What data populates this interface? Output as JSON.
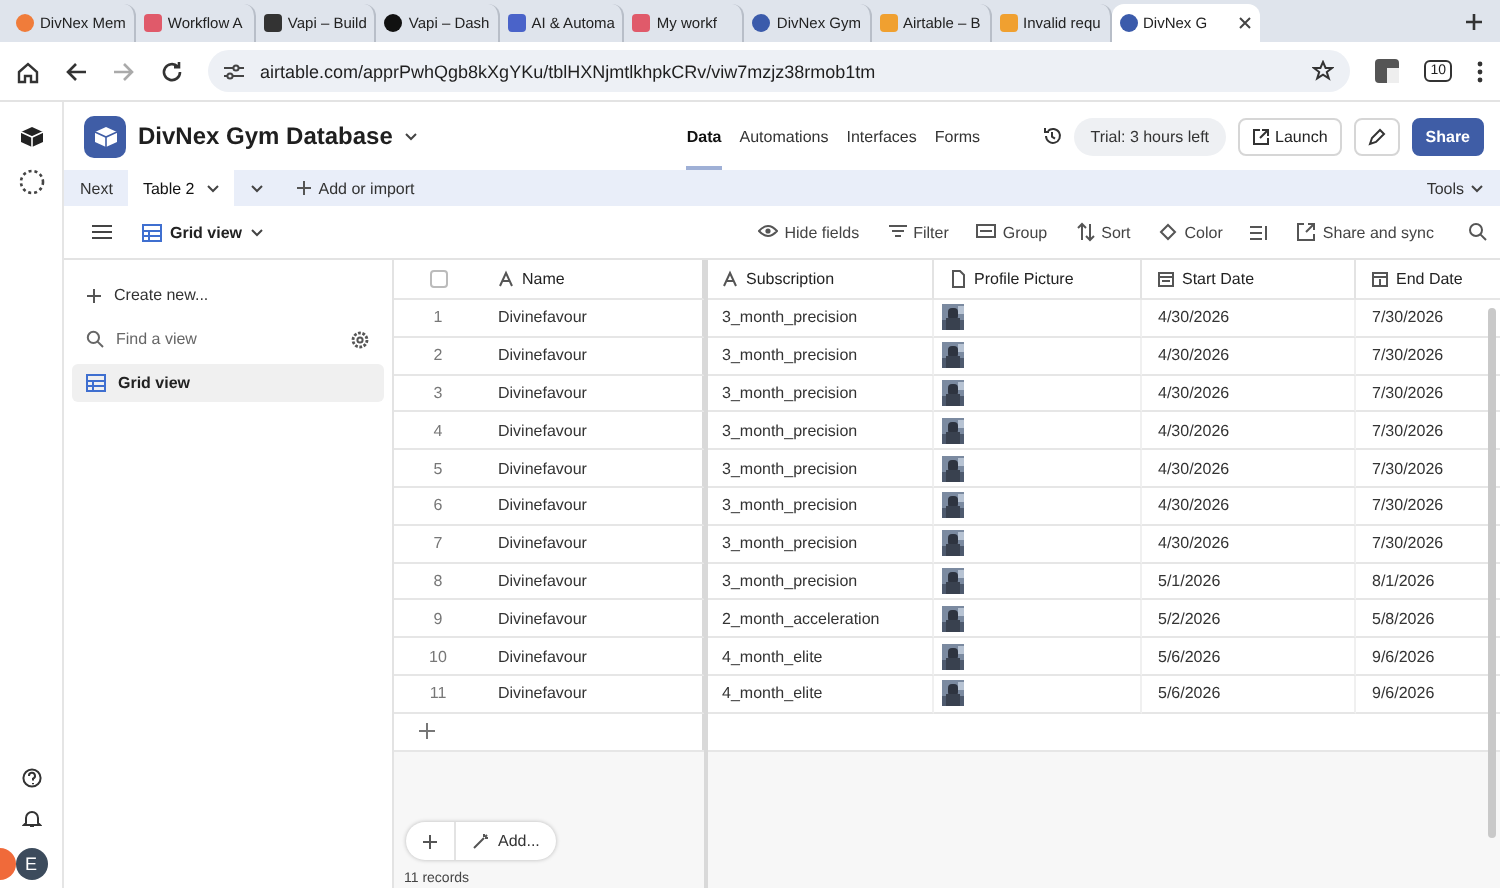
{
  "browser_tabs": [
    {
      "title": "DivNex Mem",
      "selected": false
    },
    {
      "title": "Workflow A",
      "selected": false
    },
    {
      "title": "Vapi – Build",
      "selected": false
    },
    {
      "title": "Vapi – Dash",
      "selected": false
    },
    {
      "title": "AI & Automa",
      "selected": false
    },
    {
      "title": "My workf",
      "selected": false
    },
    {
      "title": "DivNex Gym",
      "selected": false
    },
    {
      "title": "Airtable – B",
      "selected": false
    },
    {
      "title": "Invalid requ",
      "selected": false
    },
    {
      "title": "DivNex G",
      "selected": true
    }
  ],
  "address_bar": {
    "url": "airtable.com/apprPwhQgb8kXgYKu/tblHXNjmtlkhpkCRv/viw7mzjz38rmob1tm",
    "extensions_badge": "10"
  },
  "base": {
    "title": "DivNex Gym Database"
  },
  "nav_tabs": [
    {
      "label": "Data",
      "selected": true
    },
    {
      "label": "Automations",
      "selected": false
    },
    {
      "label": "Interfaces",
      "selected": false
    },
    {
      "label": "Forms",
      "selected": false
    }
  ],
  "trial_badge": "Trial: 3 hours left",
  "header_buttons": {
    "launch": "Launch",
    "share": "Share"
  },
  "table_bar": {
    "prev_label": "Next",
    "tables": [
      {
        "label": "Table 2",
        "selected": true
      }
    ],
    "add_label": "Add or import",
    "tools_label": "Tools"
  },
  "view_bar": {
    "view_name": "Grid view",
    "actions": [
      "Hide fields",
      "Filter",
      "Group",
      "Sort",
      "Color",
      "Share and sync"
    ]
  },
  "sidebar": {
    "create_label": "Create new...",
    "search": {
      "placeholder": "Find a view"
    },
    "items": [
      {
        "label": "Grid view",
        "selected": true
      }
    ]
  },
  "table": {
    "select_all": {
      "checked": false
    },
    "columns": [
      "Name",
      "Subscription",
      "Profile Picture",
      "Start Date",
      "End Date"
    ],
    "rows": [
      {
        "number": "1",
        "name": "Divinefavour",
        "subscription": "3_month_precision",
        "start": "4/30/2026",
        "end": "7/30/2026"
      },
      {
        "number": "2",
        "name": "Divinefavour",
        "subscription": "3_month_precision",
        "start": "4/30/2026",
        "end": "7/30/2026"
      },
      {
        "number": "3",
        "name": "Divinefavour",
        "subscription": "3_month_precision",
        "start": "4/30/2026",
        "end": "7/30/2026"
      },
      {
        "number": "4",
        "name": "Divinefavour",
        "subscription": "3_month_precision",
        "start": "4/30/2026",
        "end": "7/30/2026"
      },
      {
        "number": "5",
        "name": "Divinefavour",
        "subscription": "3_month_precision",
        "start": "4/30/2026",
        "end": "7/30/2026"
      },
      {
        "number": "6",
        "name": "Divinefavour",
        "subscription": "3_month_precision",
        "start": "4/30/2026",
        "end": "7/30/2026"
      },
      {
        "number": "7",
        "name": "Divinefavour",
        "subscription": "3_month_precision",
        "start": "4/30/2026",
        "end": "7/30/2026"
      },
      {
        "number": "8",
        "name": "Divinefavour",
        "subscription": "3_month_precision",
        "start": "5/1/2026",
        "end": "8/1/2026"
      },
      {
        "number": "9",
        "name": "Divinefavour",
        "subscription": "2_month_acceleration",
        "start": "5/2/2026",
        "end": "5/8/2026"
      },
      {
        "number": "10",
        "name": "Divinefavour",
        "subscription": "4_month_elite",
        "start": "5/6/2026",
        "end": "9/6/2026"
      },
      {
        "number": "11",
        "name": "Divinefavour",
        "subscription": "4_month_elite",
        "start": "5/6/2026",
        "end": "9/6/2026"
      }
    ]
  },
  "footer": {
    "add_label": "Add...",
    "record_count": "11 records"
  },
  "user": {
    "initial": "E"
  }
}
